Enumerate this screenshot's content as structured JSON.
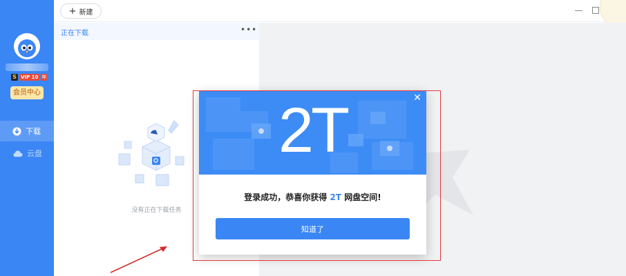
{
  "sidebar": {
    "vip_label": "VIP",
    "vip_level": "10",
    "vip_year": "年",
    "member_center": "会员中心",
    "nav": [
      {
        "label": "下载",
        "icon": "download-icon",
        "active": true
      },
      {
        "label": "云盘",
        "icon": "cloud-icon",
        "active": false
      }
    ]
  },
  "toolbar": {
    "new_label": "新建"
  },
  "downloads": {
    "title": "正在下载",
    "more_icon": "more-dots-icon",
    "empty_text": "没有正在下载任务"
  },
  "dialog": {
    "banner_text": "2T",
    "message_prefix": "登录成功，恭喜你获得 ",
    "message_highlight": "2T",
    "message_suffix": " 网盘空间!",
    "ok_label": "知道了",
    "close_icon": "close-icon"
  },
  "colors": {
    "brand_blue": "#3b86f5",
    "highlight_red": "#e0393b",
    "member_bg": "#fce7a9"
  }
}
